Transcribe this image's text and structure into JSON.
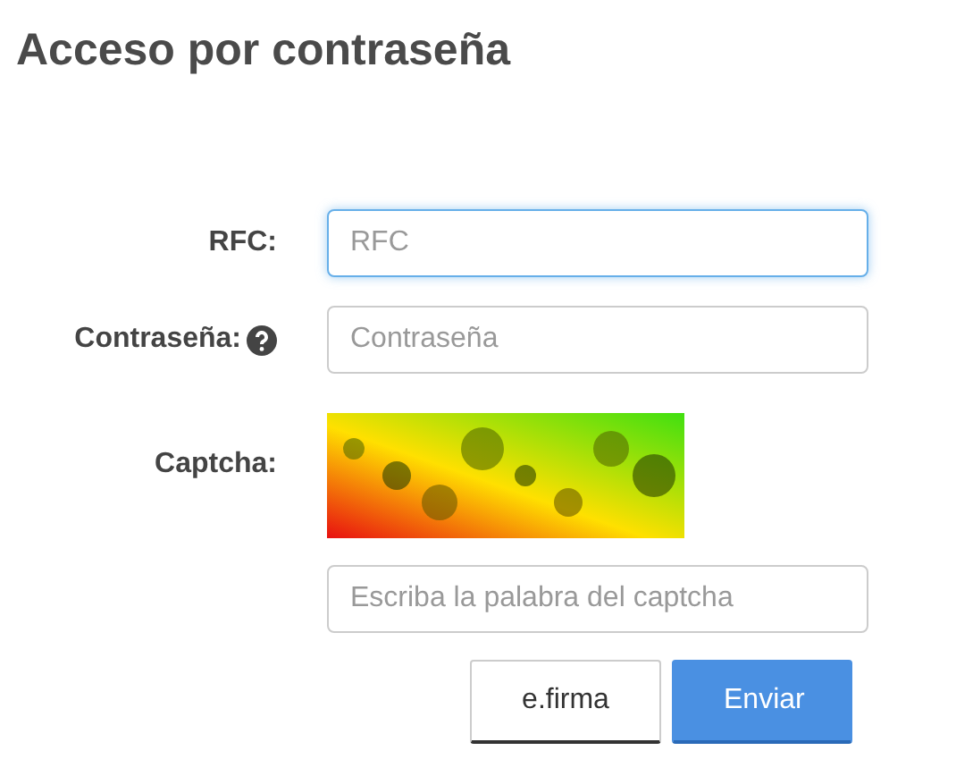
{
  "title": "Acceso por contraseña",
  "fields": [
    {
      "label": "RFC:",
      "placeholder": "RFC",
      "focused": true,
      "help": false
    },
    {
      "label": "Contraseña:",
      "placeholder": "Contraseña",
      "focused": false,
      "help": true
    }
  ],
  "captcha": {
    "label": "Captcha:",
    "kind": "picture",
    "placeholder": "Escriba la palabra del captcha",
    "focused": false
  },
  "buttons": [
    {
      "label": "e.firma",
      "kind": "secondary"
    },
    {
      "label": "Enviar",
      "kind": "primary"
    }
  ]
}
